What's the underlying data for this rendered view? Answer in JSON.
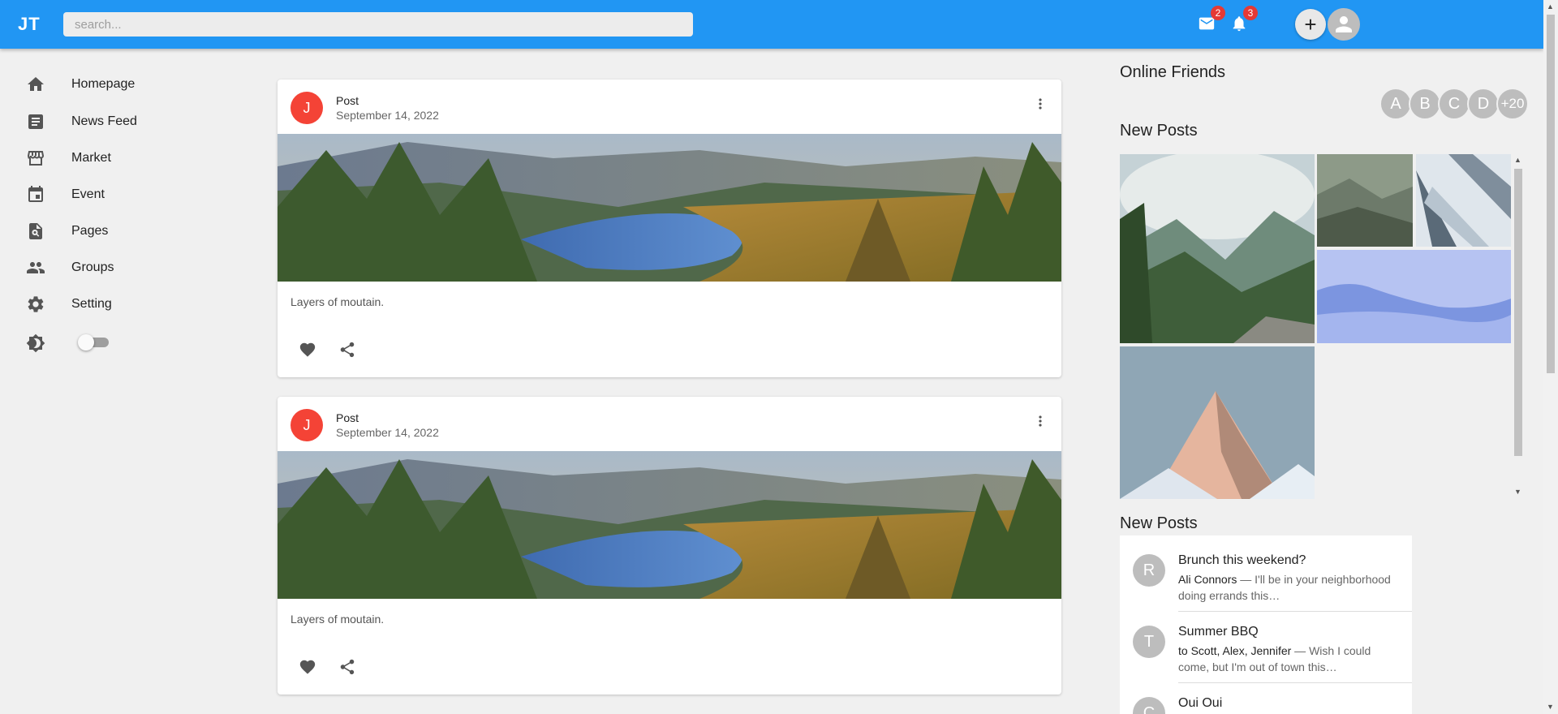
{
  "app": {
    "logo_text": "JT",
    "accent_color": "#2196f3",
    "search_placeholder": "search..."
  },
  "topbar": {
    "mail_badge": "2",
    "notif_badge": "3",
    "add_label": "+"
  },
  "sidebar": {
    "items": [
      {
        "label": "Homepage",
        "icon": "home-icon"
      },
      {
        "label": "News Feed",
        "icon": "article-icon"
      },
      {
        "label": "Market",
        "icon": "storefront-icon"
      },
      {
        "label": "Event",
        "icon": "calendar-icon"
      },
      {
        "label": "Pages",
        "icon": "page-search-icon"
      },
      {
        "label": "Groups",
        "icon": "groups-icon"
      },
      {
        "label": "Setting",
        "icon": "gear-icon"
      }
    ],
    "theme_toggle": {
      "icon": "brightness-icon",
      "on": false
    }
  },
  "feed": {
    "posts": [
      {
        "avatar": "J",
        "title": "Post",
        "date": "September 14, 2022",
        "description": "Layers of moutain."
      },
      {
        "avatar": "J",
        "title": "Post",
        "date": "September 14, 2022",
        "description": "Layers of moutain."
      }
    ]
  },
  "right": {
    "online_title": "Online Friends",
    "friends": [
      "A",
      "B",
      "C",
      "D",
      "+20"
    ],
    "gallery_title": "New Posts",
    "messages_title": "New Posts",
    "messages": [
      {
        "avatar": "R",
        "title": "Brunch this weekend?",
        "from": "Ali Connors",
        "text": " — I'll be in your neighborhood doing errands this…"
      },
      {
        "avatar": "T",
        "title": "Summer BBQ",
        "from": "to Scott, Alex, Jennifer",
        "text": " — Wish I could come, but I'm out of town this…"
      },
      {
        "avatar": "C",
        "title": "Oui Oui",
        "from": "",
        "text": ""
      }
    ]
  }
}
